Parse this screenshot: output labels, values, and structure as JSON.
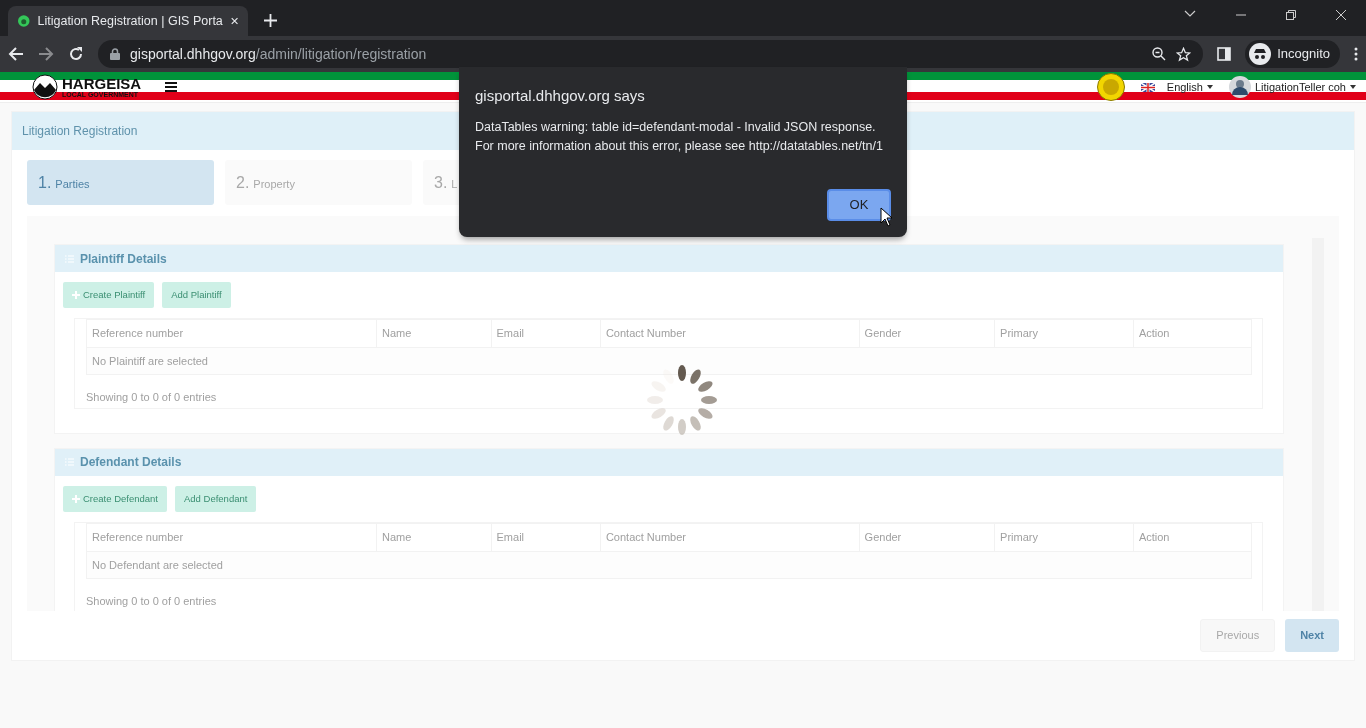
{
  "browser": {
    "tab_title": "Litigation Registration | GIS Porta",
    "url_host": "gisportal.dhhgov.org",
    "url_path": "/admin/litigation/registration",
    "profile": "Incognito"
  },
  "header": {
    "logo_title": "HARGEISA",
    "logo_subtitle": "LOCAL GOVERNMENT",
    "language": "English",
    "user": "LitigationTeller coh"
  },
  "page_title": "Litigation Registration",
  "steps": [
    {
      "number": "1.",
      "label": "Parties",
      "selected": true
    },
    {
      "number": "2.",
      "label": "Property",
      "selected": false
    },
    {
      "number": "3.",
      "label": "L",
      "selected": false
    }
  ],
  "sections": [
    {
      "title": "Plaintiff Details",
      "buttons": [
        {
          "label": "Create Plaintiff",
          "kind": "create"
        },
        {
          "label": "Add Plaintiff",
          "kind": "add"
        }
      ],
      "columns": [
        "Reference number",
        "Name",
        "Email",
        "Contact Number",
        "Gender",
        "Primary",
        "Action"
      ],
      "empty_message": "No Plaintiff are selected",
      "info": "Showing 0 to 0 of 0 entries"
    },
    {
      "title": "Defendant Details",
      "buttons": [
        {
          "label": "Create Defendant",
          "kind": "create"
        },
        {
          "label": "Add Defendant",
          "kind": "add"
        }
      ],
      "columns": [
        "Reference number",
        "Name",
        "Email",
        "Contact Number",
        "Gender",
        "Primary",
        "Action"
      ],
      "empty_message": "No Defendant are selected",
      "info": "Showing 0 to 0 of 0 entries"
    }
  ],
  "footer_buttons": [
    {
      "label": "Previous",
      "disabled": true
    },
    {
      "label": "Next",
      "disabled": false
    }
  ],
  "dialog": {
    "title": "gisportal.dhhgov.org says",
    "message": "DataTables warning: table id=defendant-modal - Invalid JSON response. For more information about this error, please see http://datatables.net/tn/1",
    "button": "OK"
  }
}
